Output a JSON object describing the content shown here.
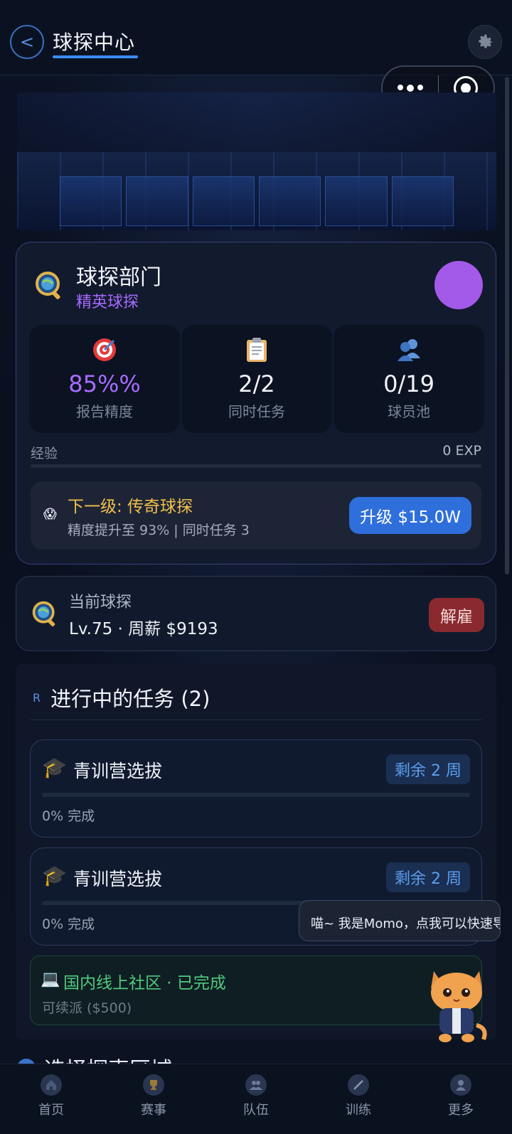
{
  "header": {
    "title": "球探中心",
    "back_label": "<"
  },
  "department": {
    "title": "球探部门",
    "level": "精英球探",
    "stats": [
      {
        "icon": "target-icon",
        "value": "85%%",
        "label": "报告精度"
      },
      {
        "icon": "clipboard-icon",
        "value": "2/2",
        "label": "同时任务"
      },
      {
        "icon": "player-icon",
        "value": "0/19",
        "label": "球员池"
      }
    ],
    "exp_label": "经验",
    "exp_value": "0 EXP",
    "exp_progress": 0,
    "next_level": {
      "title": "下一级: 传奇球探",
      "desc": "精度提升至 93% | 同时任务 3",
      "upgrade_label": "升级 $15.0W"
    }
  },
  "current_scout": {
    "label": "当前球探",
    "info": "Lv.75 · 周薪 $9193",
    "fire_label": "解雇"
  },
  "tasks": {
    "mark": "R",
    "title": "进行中的任务 (2)",
    "items": [
      {
        "name": "青训营选拔",
        "remaining": "剩余 2 周",
        "progress": "0% 完成",
        "fraction": 0
      },
      {
        "name": "青训营选拔",
        "remaining": "剩余 2 周",
        "progress": "0% 完成",
        "fraction": 0
      }
    ],
    "completed": {
      "title": "国内线上社区 · 已完成",
      "subtitle": "可续派 ($500)"
    }
  },
  "momo_tip": "喵~ 我是Momo，点我可以快速导航",
  "next_section_title": "选择探索区域",
  "tabbar": [
    {
      "icon": "home-icon",
      "label": "首页"
    },
    {
      "icon": "trophy-icon",
      "label": "赛事"
    },
    {
      "icon": "team-icon",
      "label": "队伍"
    },
    {
      "icon": "training-icon",
      "label": "训练"
    },
    {
      "icon": "profile-icon",
      "label": "更多"
    }
  ],
  "colors": {
    "accent": "#3b8cff",
    "purple": "#a86cff",
    "gold": "#f2c04a",
    "success": "#4fc97e",
    "danger": "#8a2a2e"
  }
}
